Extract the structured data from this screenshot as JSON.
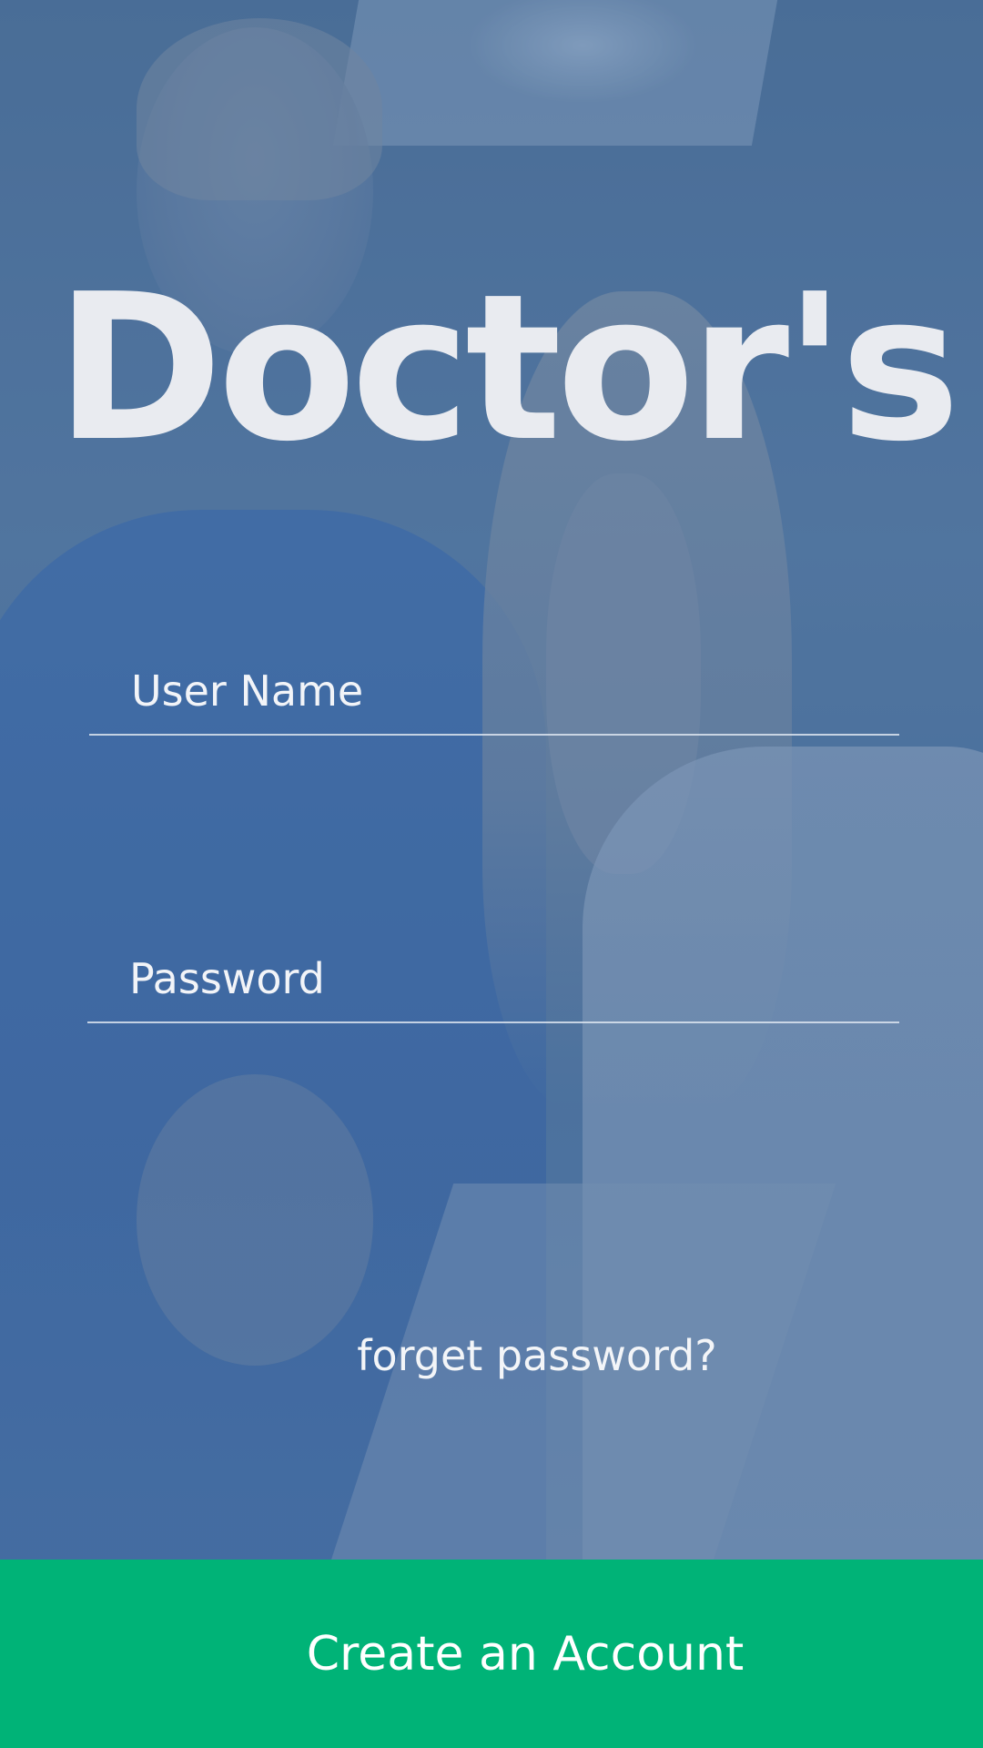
{
  "app": {
    "title": "Doctor's"
  },
  "login_form": {
    "username_placeholder": "User Name",
    "password_placeholder": "Password",
    "username_value": "",
    "password_value": ""
  },
  "links": {
    "forgot_password": "forget password?"
  },
  "actions": {
    "create_account_label": "Create an Account"
  },
  "colors": {
    "accent_green": "#00b377",
    "title_text": "#e9ebf0",
    "overlay_blue": "#4a6f98"
  }
}
